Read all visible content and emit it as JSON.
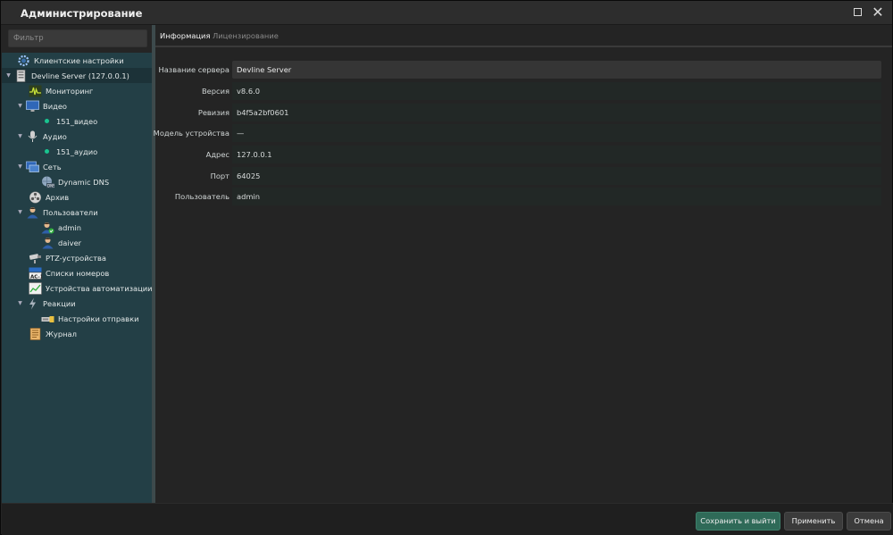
{
  "window": {
    "title": "Администрирование"
  },
  "sidebar": {
    "filter_placeholder": "Фильтр",
    "items": [
      {
        "label": "Клиентские настройки"
      },
      {
        "label": "Devline Server (127.0.0.1)"
      },
      {
        "label": "Мониторинг"
      },
      {
        "label": "Видео"
      },
      {
        "label": "151_видео"
      },
      {
        "label": "Аудио"
      },
      {
        "label": "151_аудио"
      },
      {
        "label": "Сеть"
      },
      {
        "label": "Dynamic DNS"
      },
      {
        "label": "Архив"
      },
      {
        "label": "Пользователи"
      },
      {
        "label": "admin"
      },
      {
        "label": "daiver"
      },
      {
        "label": "PTZ-устройства"
      },
      {
        "label": "Списки номеров"
      },
      {
        "label": "Устройства автоматизации"
      },
      {
        "label": "Реакции"
      },
      {
        "label": "Настройки отправки"
      },
      {
        "label": "Журнал"
      }
    ],
    "status_color": "#19c48f"
  },
  "tabs": [
    {
      "label": "Информация"
    },
    {
      "label": "Лицензирование"
    }
  ],
  "info": {
    "rows": [
      {
        "label": "Название сервера",
        "value": "Devline Server"
      },
      {
        "label": "Версия",
        "value": "v8.6.0"
      },
      {
        "label": "Ревизия",
        "value": "b4f5a2bf0601"
      },
      {
        "label": "Модель устройства",
        "value": "—"
      },
      {
        "label": "Адрес",
        "value": "127.0.0.1"
      },
      {
        "label": "Порт",
        "value": "64025"
      },
      {
        "label": "Пользователь",
        "value": "admin"
      }
    ]
  },
  "footer": {
    "save_exit": "Сохранить и выйти",
    "apply": "Применить",
    "cancel": "Отмена"
  },
  "colors": {
    "accent": "#2f6a58",
    "sidebar_bg": "#233f46"
  }
}
